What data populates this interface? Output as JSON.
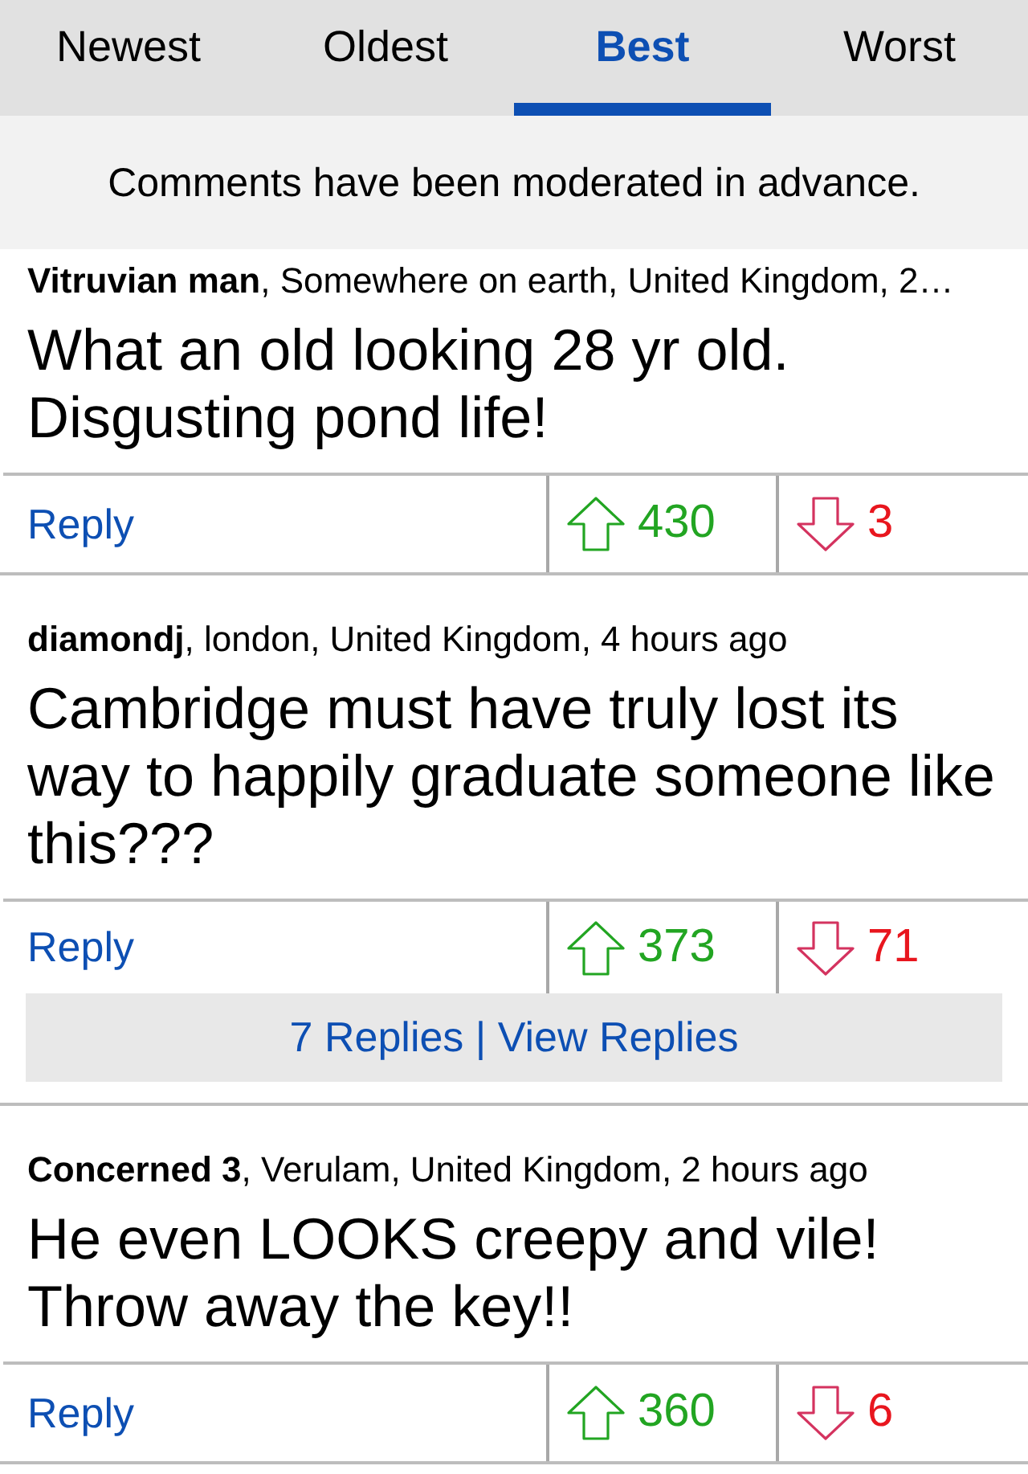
{
  "tabs": [
    {
      "label": "Newest",
      "selected": false
    },
    {
      "label": "Oldest",
      "selected": false
    },
    {
      "label": "Best",
      "selected": true
    },
    {
      "label": "Worst",
      "selected": false
    }
  ],
  "notice": "Comments have been moderated in advance.",
  "comments": [
    {
      "byline": "**Vitruvian man**, Somewhere on earth, United Kingdom, 2…",
      "body": "What an old looking 28 yr old. Disgusting pond life!",
      "reply": "Reply",
      "upvotes": "430",
      "downvotes": "3"
    },
    {
      "byline": "**diamondj**, london, United Kingdom, 4 hours ago",
      "body": "Cambridge must have truly lost its way to happily graduate someone like this???",
      "reply": "Reply",
      "upvotes": "373",
      "downvotes": "71",
      "replies_link": "7 Replies | View Replies"
    },
    {
      "byline": "**Concerned 3**, Verulam, United Kingdom, 2 hours ago",
      "body": "He even LOOKS creepy and vile! Throw away the key!!",
      "reply": "Reply",
      "upvotes": "360",
      "downvotes": "6"
    }
  ]
}
